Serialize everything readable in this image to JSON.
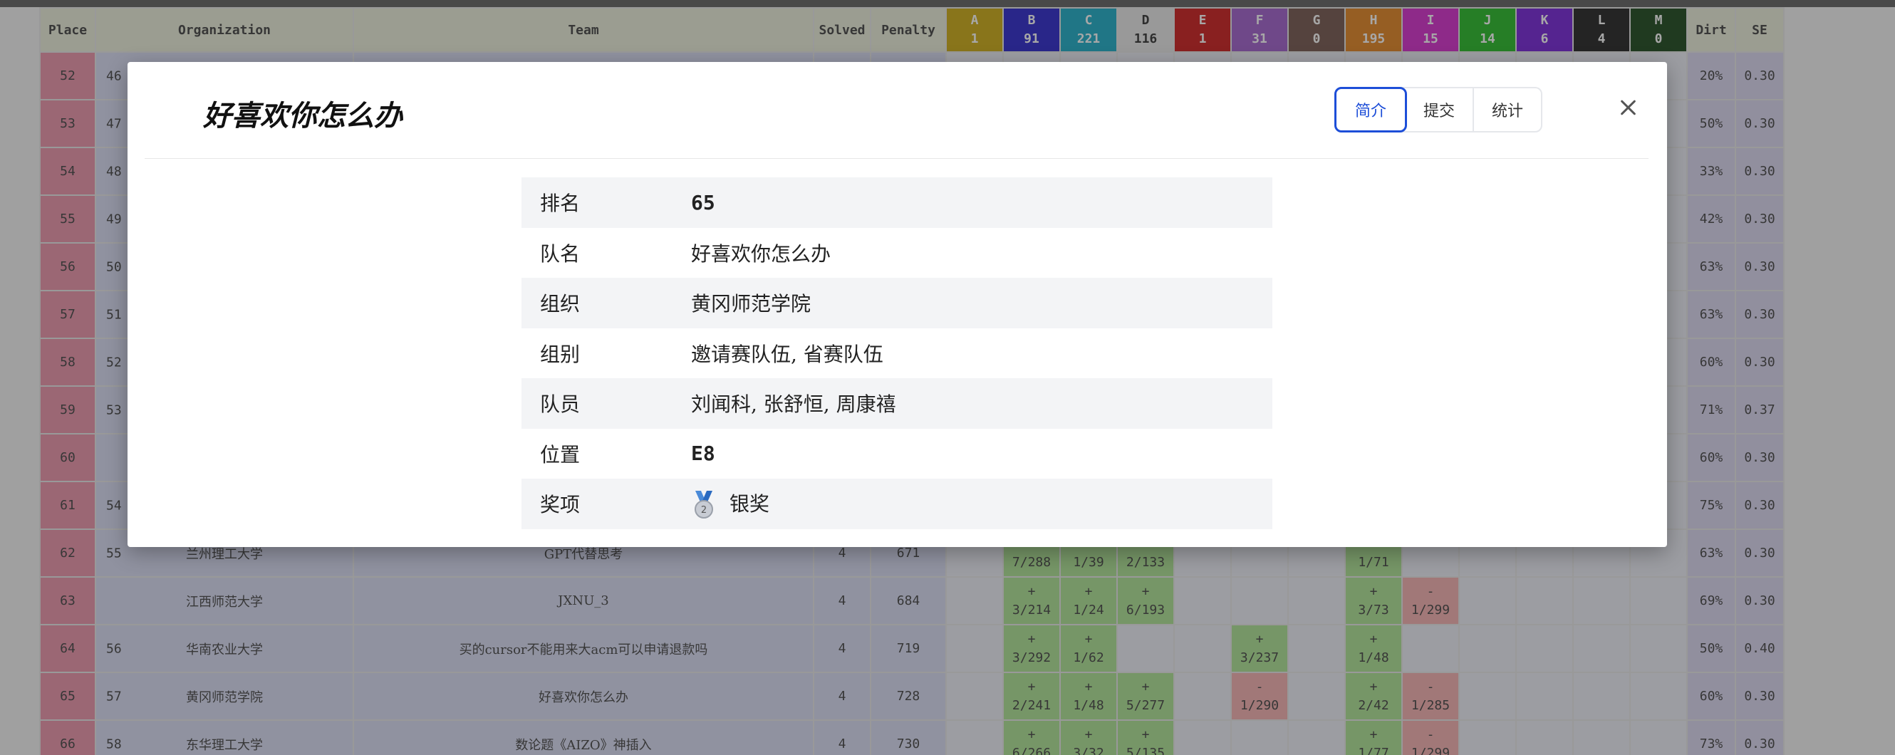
{
  "header": {
    "place": "Place",
    "organization": "Organization",
    "team": "Team",
    "solved": "Solved",
    "penalty": "Penalty",
    "dirt": "Dirt",
    "se": "SE"
  },
  "problems": [
    {
      "letter": "A",
      "count": "1",
      "color": "#c8a400"
    },
    {
      "letter": "B",
      "count": "91",
      "color": "#1a14c8"
    },
    {
      "letter": "C",
      "count": "221",
      "color": "#0aa7c4"
    },
    {
      "letter": "D",
      "count": "116",
      "color": "#e6e6e6"
    },
    {
      "letter": "E",
      "count": "1",
      "color": "#c80a0a"
    },
    {
      "letter": "F",
      "count": "31",
      "color": "#9a52c9"
    },
    {
      "letter": "G",
      "count": "0",
      "color": "#6a4a40"
    },
    {
      "letter": "H",
      "count": "195",
      "color": "#e07a10"
    },
    {
      "letter": "I",
      "count": "15",
      "color": "#d21cc8"
    },
    {
      "letter": "J",
      "count": "14",
      "color": "#14b414"
    },
    {
      "letter": "K",
      "count": "6",
      "color": "#6a12d6"
    },
    {
      "letter": "L",
      "count": "4",
      "color": "#111111"
    },
    {
      "letter": "M",
      "count": "0",
      "color": "#0a3a0a"
    }
  ],
  "rows": [
    {
      "place": "52",
      "ord": "46",
      "org": "",
      "team": "",
      "solved": "",
      "penalty": "",
      "cells": {},
      "dirt": "20%",
      "se": "0.30"
    },
    {
      "place": "53",
      "ord": "47",
      "org": "",
      "team": "",
      "solved": "",
      "penalty": "",
      "cells": {},
      "dirt": "50%",
      "se": "0.30"
    },
    {
      "place": "54",
      "ord": "48",
      "org": "",
      "team": "",
      "solved": "",
      "penalty": "",
      "cells": {},
      "dirt": "33%",
      "se": "0.30"
    },
    {
      "place": "55",
      "ord": "49",
      "org": "",
      "team": "",
      "solved": "",
      "penalty": "",
      "cells": {},
      "dirt": "42%",
      "se": "0.30"
    },
    {
      "place": "56",
      "ord": "50",
      "org": "",
      "team": "",
      "solved": "",
      "penalty": "",
      "cells": {},
      "dirt": "63%",
      "se": "0.30"
    },
    {
      "place": "57",
      "ord": "51",
      "org": "",
      "team": "",
      "solved": "",
      "penalty": "",
      "cells": {},
      "dirt": "63%",
      "se": "0.30"
    },
    {
      "place": "58",
      "ord": "52",
      "org": "",
      "team": "",
      "solved": "",
      "penalty": "",
      "cells": {},
      "dirt": "60%",
      "se": "0.30"
    },
    {
      "place": "59",
      "ord": "53",
      "org": "",
      "team": "",
      "solved": "",
      "penalty": "",
      "cells": {},
      "dirt": "71%",
      "se": "0.37"
    },
    {
      "place": "60",
      "ord": "",
      "org": "",
      "team": "",
      "solved": "",
      "penalty": "",
      "cells": {},
      "dirt": "60%",
      "se": "0.30"
    },
    {
      "place": "61",
      "ord": "54",
      "org": "",
      "team": "",
      "solved": "",
      "penalty": "",
      "cells": {},
      "dirt": "75%",
      "se": "0.30"
    },
    {
      "place": "62",
      "ord": "55",
      "org": "兰州理工大学",
      "team": "GPT代替思考",
      "solved": "4",
      "penalty": "671",
      "cells": {
        "B": [
          "",
          "7/288",
          "ac"
        ],
        "C": [
          "",
          "1/39",
          "ac"
        ],
        "D": [
          "",
          "2/133",
          "ac"
        ],
        "H": [
          "",
          "1/71",
          "ac"
        ]
      },
      "dirt": "63%",
      "se": "0.30"
    },
    {
      "place": "63",
      "ord": "",
      "org": "江西师范大学",
      "team": "JXNU_3",
      "solved": "4",
      "penalty": "684",
      "cells": {
        "B": [
          "+",
          "3/214",
          "ac"
        ],
        "C": [
          "+",
          "1/24",
          "ac"
        ],
        "D": [
          "+",
          "6/193",
          "ac"
        ],
        "H": [
          "+",
          "3/73",
          "ac"
        ],
        "I": [
          "-",
          "1/299",
          "wa"
        ]
      },
      "dirt": "69%",
      "se": "0.30"
    },
    {
      "place": "64",
      "ord": "56",
      "org": "华南农业大学",
      "team": "买的cursor不能用来大acm可以申请退款吗",
      "solved": "4",
      "penalty": "719",
      "cells": {
        "B": [
          "+",
          "3/292",
          "ac"
        ],
        "C": [
          "+",
          "1/62",
          "ac"
        ],
        "F": [
          "+",
          "3/237",
          "ac"
        ],
        "H": [
          "+",
          "1/48",
          "ac"
        ]
      },
      "dirt": "50%",
      "se": "0.40"
    },
    {
      "place": "65",
      "ord": "57",
      "org": "黄冈师范学院",
      "team": "好喜欢你怎么办",
      "solved": "4",
      "penalty": "728",
      "cells": {
        "B": [
          "+",
          "2/241",
          "ac"
        ],
        "C": [
          "+",
          "1/48",
          "ac"
        ],
        "D": [
          "+",
          "5/277",
          "ac"
        ],
        "F": [
          "-",
          "1/290",
          "wa"
        ],
        "H": [
          "+",
          "2/42",
          "ac"
        ],
        "I": [
          "-",
          "1/285",
          "wa"
        ]
      },
      "dirt": "60%",
      "se": "0.30"
    },
    {
      "place": "66",
      "ord": "58",
      "org": "东华理工大学",
      "team": "数论题《AIZO》神插入",
      "solved": "4",
      "penalty": "730",
      "cells": {
        "B": [
          "+",
          "6/266",
          "ac"
        ],
        "C": [
          "+",
          "3/32",
          "ac"
        ],
        "D": [
          "+",
          "5/135",
          "ac"
        ],
        "H": [
          "+",
          "1/77",
          "ac"
        ],
        "I": [
          "-",
          "1/299",
          "wa"
        ]
      },
      "dirt": "73%",
      "se": "0.30"
    }
  ],
  "modal": {
    "title": "好喜欢你怎么办",
    "tabs": [
      "简介",
      "提交",
      "统计"
    ],
    "active_tab": 0,
    "info": [
      {
        "key": "排名",
        "value": "65",
        "mono": true
      },
      {
        "key": "队名",
        "value": "好喜欢你怎么办",
        "mono": false
      },
      {
        "key": "组织",
        "value": "黄冈师范学院",
        "mono": false
      },
      {
        "key": "组别",
        "value": "邀请赛队伍, 省赛队伍",
        "mono": false
      },
      {
        "key": "队员",
        "value": "刘闻科, 张舒恒, 周康禧",
        "mono": false
      },
      {
        "key": "位置",
        "value": "E8",
        "mono": true
      },
      {
        "key": "奖项",
        "value": "银奖",
        "mono": false,
        "medal": "silver-medal-icon",
        "medal_number": "2"
      }
    ]
  }
}
